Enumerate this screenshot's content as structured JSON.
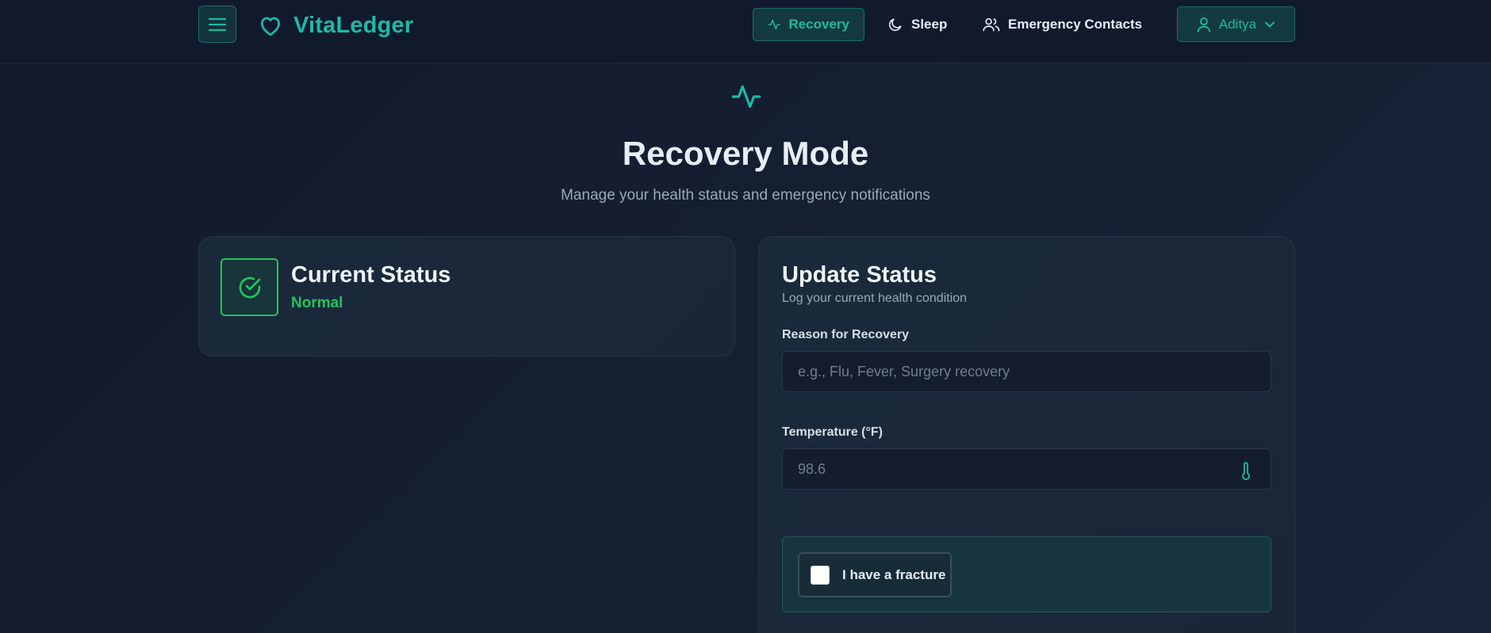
{
  "app": {
    "name": "VitaLedger"
  },
  "nav": {
    "items": [
      {
        "label": "Recovery",
        "icon": "activity-icon",
        "active": true
      },
      {
        "label": "Sleep",
        "icon": "moon-icon",
        "active": false
      },
      {
        "label": "Emergency Contacts",
        "icon": "users-icon",
        "active": false
      }
    ],
    "user": {
      "name": "Aditya"
    }
  },
  "page": {
    "title": "Recovery Mode",
    "subtitle": "Manage your health status and emergency notifications"
  },
  "current_status": {
    "title": "Current Status",
    "value": "Normal"
  },
  "update_status": {
    "title": "Update Status",
    "subtitle": "Log your current health condition",
    "reason": {
      "label": "Reason for Recovery",
      "placeholder": "e.g., Flu, Fever, Surgery recovery",
      "value": ""
    },
    "temperature": {
      "label": "Temperature (°F)",
      "placeholder": "98.6",
      "value": ""
    },
    "fracture": {
      "label": "I have a fracture",
      "checked": false
    }
  },
  "colors": {
    "accent": "#1fb8a4",
    "status_ok": "#22c55e",
    "background": "#131b2e"
  }
}
